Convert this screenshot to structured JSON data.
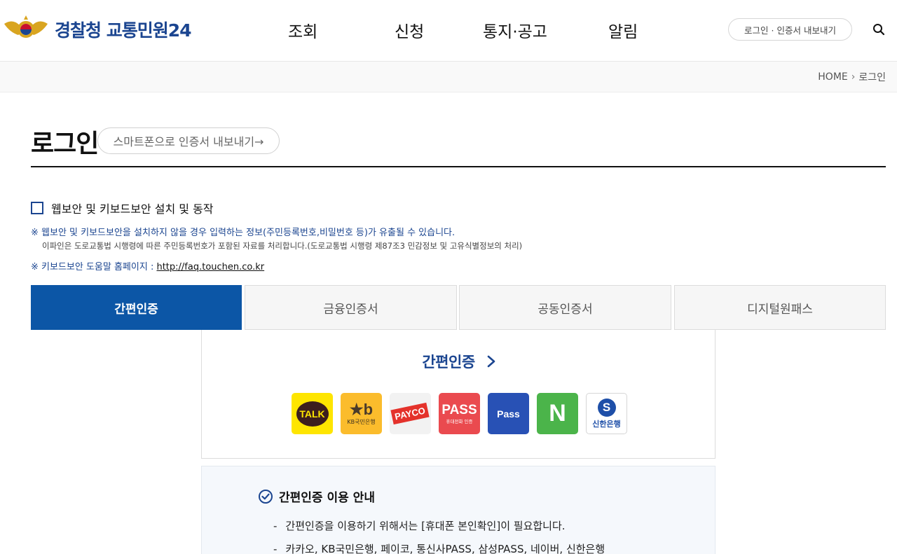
{
  "header": {
    "logo_text": "경찰청 교통민원24",
    "nav": [
      "조회",
      "신청",
      "통지·공고",
      "알림"
    ],
    "login_button": "로그인 · 인증서 내보내기"
  },
  "breadcrumb": {
    "home": "HOME",
    "current": "로그인"
  },
  "page": {
    "title": "로그인",
    "export_button": "스마트폰으로 인증서 내보내기→"
  },
  "security": {
    "checkbox_label": "웹보안 및 키보드보안 설치 및 동작",
    "note1": "※ 웹보안 및 키보드보안을 설치하지 않을 경우 입력하는 정보(주민등록번호,비밀번호 등)가 유출될 수 있습니다.",
    "note2": "이파인은 도로교통법 시행령에 따른 주민등록번호가 포함된 자료를 처리합니다.(도로교통법 시행령 제87조3 민감정보 및 고유식별정보의 처리)",
    "note3_prefix": "※ 키보드보안 도움말 홈페이지 : ",
    "note3_link": "http://faq.touchen.co.kr"
  },
  "tabs": [
    "간편인증",
    "금융인증서",
    "공동인증서",
    "디지털원패스"
  ],
  "easy_auth": {
    "title": "간편인증",
    "providers": {
      "kakao": "TALK",
      "kb": "KB국민은행",
      "payco": "PAYCO",
      "pass_telecom": "PASS",
      "pass_telecom_sub": "휴대전화 인증",
      "samsung_pass": "Pass",
      "naver": "N",
      "shinhan": "신한은행"
    }
  },
  "guide": {
    "title": "간편인증 이용 안내",
    "items": [
      "간편인증을 이용하기 위해서는 [휴대폰 본인확인]이 필요합니다.",
      "카카오, KB국민은행, 페이코, 통신사PASS, 삼성PASS, 네이버, 신한은행"
    ]
  },
  "colors": {
    "primary": "#0c56a6",
    "brand_text": "#1b4590"
  }
}
